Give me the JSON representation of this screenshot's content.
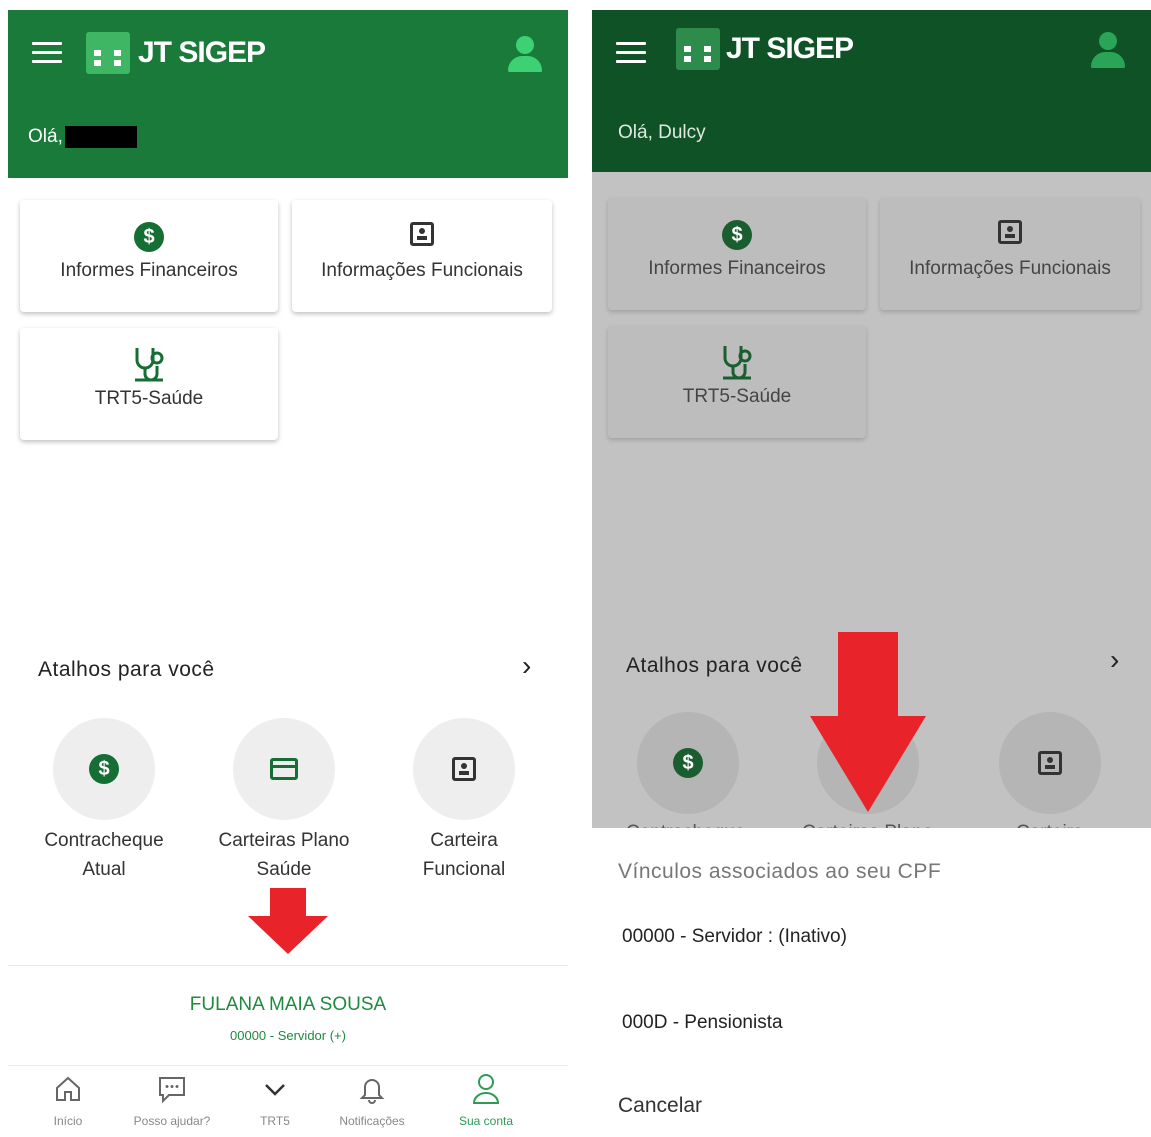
{
  "app": {
    "title": "JT SIGEP"
  },
  "left": {
    "greeting": "Olá,",
    "cards": [
      {
        "icon": "dollar-icon",
        "label": "Informes Financeiros"
      },
      {
        "icon": "badge-icon",
        "label": "Informações Funcionais"
      },
      {
        "icon": "stethoscope-icon",
        "label": "TRT5-Saúde"
      }
    ],
    "shortcuts_title": "Atalhos para você",
    "shortcuts": [
      {
        "line1": "Contracheque",
        "line2": "Atual"
      },
      {
        "line1": "Carteiras Plano",
        "line2": "Saúde"
      },
      {
        "line1": "Carteira",
        "line2": "Funcional"
      }
    ],
    "account": {
      "name": "FULANA MAIA SOUSA",
      "sub": "00000 - Servidor (+)"
    },
    "nav": [
      "Início",
      "Posso ajudar?",
      "TRT5",
      "Notificações",
      "Sua conta"
    ]
  },
  "right": {
    "greeting": "Olá, Dulcy",
    "cards": [
      {
        "icon": "dollar-icon",
        "label": "Informes Financeiros"
      },
      {
        "icon": "badge-icon",
        "label": "Informações Funcionais"
      },
      {
        "icon": "stethoscope-icon",
        "label": "TRT5-Saúde"
      }
    ],
    "shortcuts_title": "Atalhos para você",
    "cut_labels": [
      "Contracheque",
      "Carteiras Plano",
      "Carteira"
    ],
    "sheet": {
      "title": "Vínculos associados ao seu CPF",
      "options": [
        "00000 - Servidor : (Inativo)",
        "000D - Pensionista"
      ],
      "cancel": "Cancelar"
    }
  },
  "colors": {
    "brand_green": "#1a7a3a",
    "accent_green": "#3eb663",
    "arrow_red": "#e8232a"
  }
}
